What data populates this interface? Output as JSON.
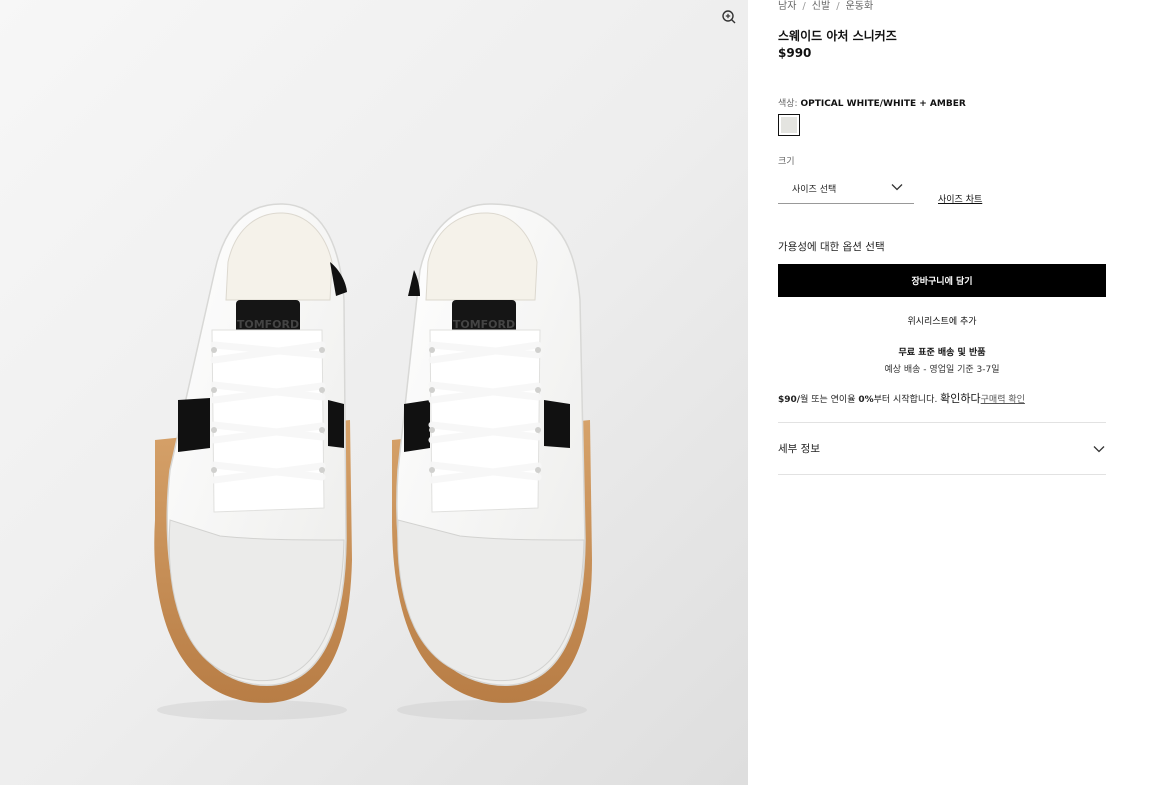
{
  "breadcrumb": [
    {
      "label": "남자"
    },
    {
      "label": "신발"
    },
    {
      "label": "운동화"
    }
  ],
  "breadcrumb_separator": "/",
  "product": {
    "title": "스웨이드 아처 스니커즈",
    "price": "$990"
  },
  "color": {
    "label": "색상:",
    "value": "OPTICAL WHITE/WHITE + AMBER",
    "swatch_color": "#e4e4e0"
  },
  "size": {
    "label": "크기",
    "select_placeholder": "사이즈 선택",
    "chart_link": "사이즈 차트"
  },
  "availability_label": "가용성에 대한 옵션 선택",
  "add_to_cart_label": "장바구니에 담기",
  "wishlist_label": "위시리스트에 추가",
  "shipping": {
    "title": "무료 표준 배송 및 반품",
    "subtitle": "예상 배송 - 영업일 기준 3-7일"
  },
  "installment": {
    "amount": "$90/",
    "text_1": "월 또는 연이율 ",
    "rate": "0%",
    "text_2": "부터 시작합니다. ",
    "confirm": "확인하다",
    "link": "구매력 확인"
  },
  "details_label": "세부 정보",
  "icons": {
    "zoom": "zoom-in-icon",
    "chevron": "chevron-down-icon"
  },
  "image_logo_text": "TOMFORD"
}
